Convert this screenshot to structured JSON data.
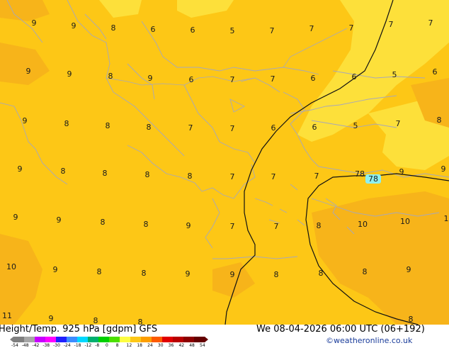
{
  "map": {
    "temp_labels": [
      {
        "t": "9",
        "c": 0
      },
      {
        "t": "9",
        "c": 0
      },
      {
        "t": "8",
        "c": 0
      },
      {
        "t": "6",
        "c": 0
      },
      {
        "t": "6",
        "c": 0
      },
      {
        "t": "5",
        "c": 0
      },
      {
        "t": "7",
        "c": 0
      },
      {
        "t": "7",
        "c": 0
      },
      {
        "t": "7",
        "c": 0
      },
      {
        "t": "7",
        "c": 0
      },
      {
        "t": "7",
        "c": 0
      },
      {
        "t": "9",
        "c": 0
      },
      {
        "t": "9",
        "c": 0
      },
      {
        "t": "8",
        "c": 0
      },
      {
        "t": "9",
        "c": 0
      },
      {
        "t": "6",
        "c": 0
      },
      {
        "t": "7",
        "c": 0
      },
      {
        "t": "7",
        "c": 0
      },
      {
        "t": "6",
        "c": 0
      },
      {
        "t": "6",
        "c": 0
      },
      {
        "t": "5",
        "c": 0
      },
      {
        "t": "6",
        "c": 0
      },
      {
        "t": "9",
        "c": 0
      },
      {
        "t": "8",
        "c": 0
      },
      {
        "t": "8",
        "c": 0
      },
      {
        "t": "8",
        "c": 0
      },
      {
        "t": "7",
        "c": 0
      },
      {
        "t": "7",
        "c": 0
      },
      {
        "t": "6",
        "c": 0
      },
      {
        "t": "6",
        "c": 0
      },
      {
        "t": "5",
        "c": 0
      },
      {
        "t": "7",
        "c": 0
      },
      {
        "t": "8",
        "c": 0
      },
      {
        "t": "9",
        "c": 0
      },
      {
        "t": "8",
        "c": 0
      },
      {
        "t": "8",
        "c": 0
      },
      {
        "t": "8",
        "c": 0
      },
      {
        "t": "8",
        "c": 0
      },
      {
        "t": "7",
        "c": 0
      },
      {
        "t": "7",
        "c": 0
      },
      {
        "t": "7",
        "c": 0
      },
      {
        "t": "78",
        "c": 0
      },
      {
        "t": "9",
        "c": 0
      },
      {
        "t": "9",
        "c": 0
      },
      {
        "t": "9",
        "c": 0
      },
      {
        "t": "9",
        "c": 0
      },
      {
        "t": "8",
        "c": 0
      },
      {
        "t": "8",
        "c": 0
      },
      {
        "t": "9",
        "c": 0
      },
      {
        "t": "7",
        "c": 0
      },
      {
        "t": "7",
        "c": 0
      },
      {
        "t": "8",
        "c": 0
      },
      {
        "t": "10",
        "c": 0
      },
      {
        "t": "10",
        "c": 0
      },
      {
        "t": "1",
        "c": 0
      },
      {
        "t": "10",
        "c": 0
      },
      {
        "t": "9",
        "c": 0
      },
      {
        "t": "8",
        "c": 0
      },
      {
        "t": "8",
        "c": 0
      },
      {
        "t": "9",
        "c": 0
      },
      {
        "t": "9",
        "c": 0
      },
      {
        "t": "8",
        "c": 0
      },
      {
        "t": "8",
        "c": 0
      },
      {
        "t": "8",
        "c": 0
      },
      {
        "t": "9",
        "c": 0
      },
      {
        "t": "11",
        "c": 0
      },
      {
        "t": "9",
        "c": 0
      },
      {
        "t": "8",
        "c": 0
      },
      {
        "t": "8",
        "c": 0
      },
      {
        "t": "8",
        "c": 0
      }
    ],
    "contour_label": "78",
    "colors": {
      "main": "#fdc716",
      "light": "#fde03a",
      "darker": "#f7b41a"
    }
  },
  "footer": {
    "title": "Height/Temp. 925 hPa [gdpm] GFS",
    "datetime": "We 08-04-2026 06:00 UTC (06+192)",
    "credit": "©weatheronline.co.uk",
    "legend_ticks": [
      "-54",
      "-48",
      "-42",
      "-38",
      "-30",
      "-24",
      "-18",
      "-12",
      "-8",
      "0",
      "8",
      "12",
      "18",
      "24",
      "30",
      "36",
      "42",
      "48",
      "54"
    ],
    "legend_colors": [
      "#7f7f7f",
      "#a6a6a6",
      "#c800ff",
      "#ff00ff",
      "#2020ff",
      "#3c8cff",
      "#00d8ff",
      "#00b070",
      "#00d000",
      "#4ce000",
      "#fdfd40",
      "#fdc716",
      "#fd9e00",
      "#fd5a00",
      "#e00000",
      "#b80000",
      "#8c0000",
      "#640000"
    ]
  }
}
